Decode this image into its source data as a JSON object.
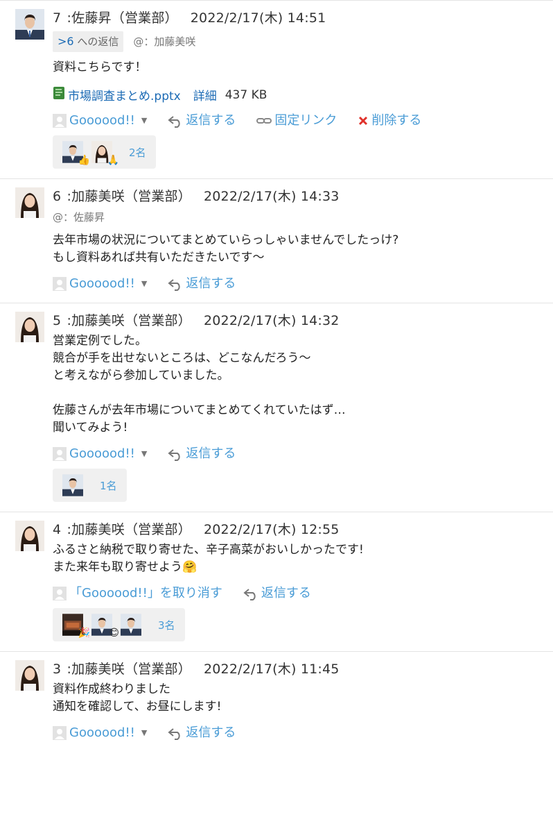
{
  "posts": [
    {
      "num": "7",
      "author": "佐藤昇（営業部）",
      "date": "2022/2/17(木) 14:51",
      "reply_to_link": ">6",
      "reply_to_suffix": " への返信",
      "mention": "@：加藤美咲",
      "body": "資料こちらです！",
      "attachment": {
        "name": "市場調査まとめ.pptx",
        "detail": "詳細",
        "size": "437 KB"
      },
      "like_label": "Goooood!!",
      "reply_label": "返信する",
      "permalink_label": "固定リンク",
      "delete_label": "削除する",
      "likers_count": "2名"
    },
    {
      "num": "6",
      "author": "加藤美咲（営業部）",
      "date": "2022/2/17(木) 14:33",
      "mention": "@：佐藤昇",
      "body": "去年市場の状況についてまとめていらっしゃいませんでしたっけ?\nもし資料あれば共有いただきたいです〜",
      "like_label": "Goooood!!",
      "reply_label": "返信する"
    },
    {
      "num": "5",
      "author": "加藤美咲（営業部）",
      "date": "2022/2/17(木) 14:32",
      "body": "営業定例でした。\n競合が手を出せないところは、どこなんだろう〜\nと考えながら参加していました。\n\n佐藤さんが去年市場についてまとめてくれていたはず…\n聞いてみよう!",
      "like_label": "Goooood!!",
      "reply_label": "返信する",
      "likers_count": "1名"
    },
    {
      "num": "4",
      "author": "加藤美咲（営業部）",
      "date": "2022/2/17(木) 12:55",
      "body": "ふるさと納税で取り寄せた、辛子高菜がおいしかったです!\nまた来年も取り寄せよう🤗",
      "unlike_label": "「Goooood!!」を取り消す",
      "reply_label": "返信する",
      "likers_count": "3名"
    },
    {
      "num": "3",
      "author": "加藤美咲（営業部）",
      "date": "2022/2/17(木) 11:45",
      "body": "資料作成終わりました\n通知を確認して、お昼にします!",
      "like_label": "Goooood!!",
      "reply_label": "返信する"
    }
  ],
  "reactions": {
    "thumbs": "👍",
    "pray": "🙏",
    "party": "🎉",
    "smile": "😊"
  },
  "colors": {
    "link": "#1c6bb5",
    "action": "#4a9cd6",
    "delete_icon": "#e0322b"
  }
}
